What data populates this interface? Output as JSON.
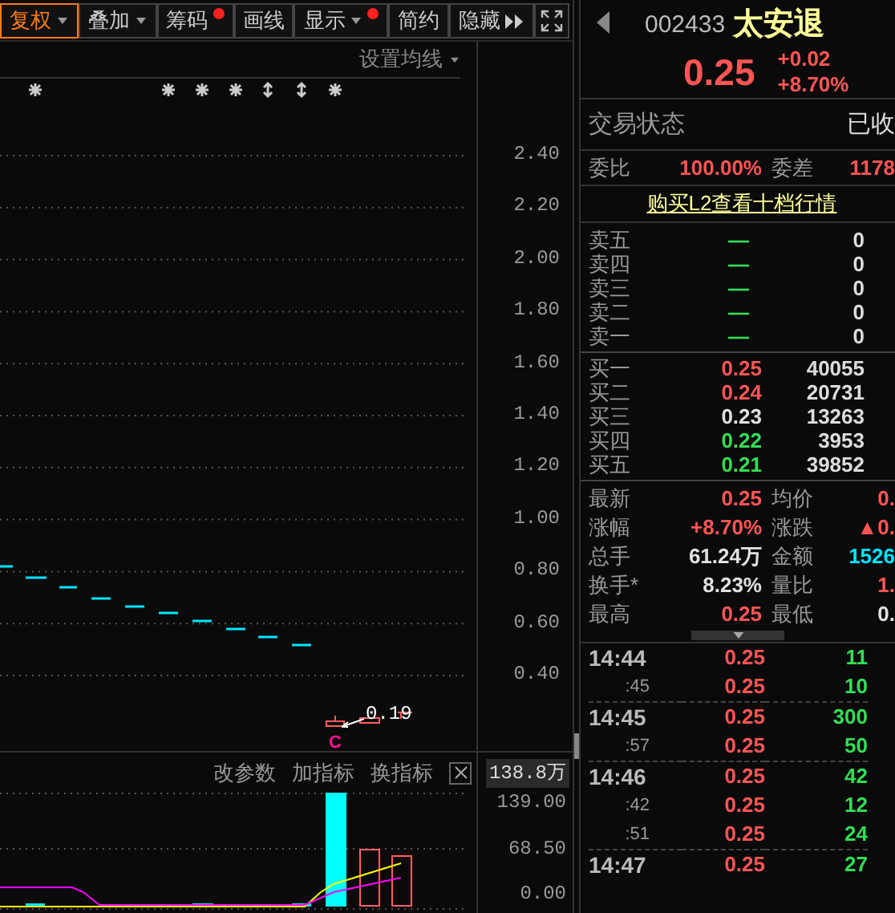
{
  "toolbar": [
    {
      "label": "复权",
      "kind": "menu",
      "selected": true
    },
    {
      "label": "叠加",
      "kind": "menu",
      "selected": false
    },
    {
      "label": "筹码",
      "kind": "marked",
      "selected": false
    },
    {
      "label": "画线",
      "kind": "plain",
      "selected": false
    },
    {
      "label": "显示",
      "kind": "menu-marked",
      "selected": false
    },
    {
      "label": "简约",
      "kind": "plain",
      "selected": false
    },
    {
      "label": "隐藏",
      "kind": "expand",
      "selected": false
    }
  ],
  "chart": {
    "ma_setting": "设置均线",
    "price_axis": [
      "2.40",
      "2.20",
      "2.00",
      "1.80",
      "1.60",
      "1.40",
      "1.20",
      "1.00",
      "0.80",
      "0.60",
      "0.40"
    ],
    "low_label": "0.19",
    "signal_mark": "C"
  },
  "indicator": {
    "buttons": [
      "改参数",
      "加指标",
      "换指标"
    ],
    "value_badge": "138.8万",
    "axis": [
      "139.00",
      "68.50",
      "0.00"
    ]
  },
  "quote": {
    "code": "002433",
    "name": "太安退",
    "price": "0.25",
    "change": "+0.02",
    "change_pct": "+8.70%",
    "status": {
      "label": "交易状态",
      "value": "已收"
    },
    "order_ratio": {
      "label": "委比",
      "value": "100.00%",
      "diff_label": "委差",
      "diff_value": "1178"
    },
    "l2_link": "购买L2查看十档行情",
    "asks": [
      {
        "label": "卖五",
        "price": "—",
        "volume": "0"
      },
      {
        "label": "卖四",
        "price": "—",
        "volume": "0"
      },
      {
        "label": "卖三",
        "price": "—",
        "volume": "0"
      },
      {
        "label": "卖二",
        "price": "—",
        "volume": "0"
      },
      {
        "label": "卖一",
        "price": "—",
        "volume": "0"
      }
    ],
    "bids": [
      {
        "label": "买一",
        "price": "0.25",
        "volume": "40055",
        "color": "#ff5555"
      },
      {
        "label": "买二",
        "price": "0.24",
        "volume": "20731",
        "color": "#ff5555"
      },
      {
        "label": "买三",
        "price": "0.23",
        "volume": "13263",
        "color": "#e0e0e0"
      },
      {
        "label": "买四",
        "price": "0.22",
        "volume": "3953",
        "color": "#33dd55"
      },
      {
        "label": "买五",
        "price": "0.21",
        "volume": "39852",
        "color": "#33dd55"
      }
    ],
    "stats": [
      {
        "label": "最新",
        "value": "0.25",
        "color": "#ff5555"
      },
      {
        "label": "均价",
        "value": "0.",
        "color": "#ff5555"
      },
      {
        "label": "涨幅",
        "value": "+8.70%",
        "color": "#ff5555"
      },
      {
        "label": "涨跌",
        "value": "▲0.",
        "color": "#ff5555"
      },
      {
        "label": "总手",
        "value": "61.24万",
        "color": "#e0e0e0"
      },
      {
        "label": "金额",
        "value": "1526",
        "color": "#00e5ff"
      },
      {
        "label": "换手*",
        "value": "8.23%",
        "color": "#e0e0e0"
      },
      {
        "label": "量比",
        "value": "1.",
        "color": "#ff5555"
      },
      {
        "label": "最高",
        "value": "0.25",
        "color": "#ff5555"
      },
      {
        "label": "最低",
        "value": "0.",
        "color": "#e0e0e0"
      }
    ],
    "ticks": [
      {
        "time": "14:44",
        "kind": "minute",
        "price": "0.25",
        "volume": "11"
      },
      {
        "time": ":45",
        "kind": "second",
        "price": "0.25",
        "volume": "10"
      },
      {
        "time": "14:45",
        "kind": "minute",
        "price": "0.25",
        "volume": "300"
      },
      {
        "time": ":57",
        "kind": "second",
        "price": "0.25",
        "volume": "50"
      },
      {
        "time": "14:46",
        "kind": "minute",
        "price": "0.25",
        "volume": "42"
      },
      {
        "time": ":42",
        "kind": "second",
        "price": "0.25",
        "volume": "12"
      },
      {
        "time": ":51",
        "kind": "second",
        "price": "0.25",
        "volume": "24"
      },
      {
        "time": "14:47",
        "kind": "minute",
        "price": "0.25",
        "volume": "27"
      }
    ]
  }
}
